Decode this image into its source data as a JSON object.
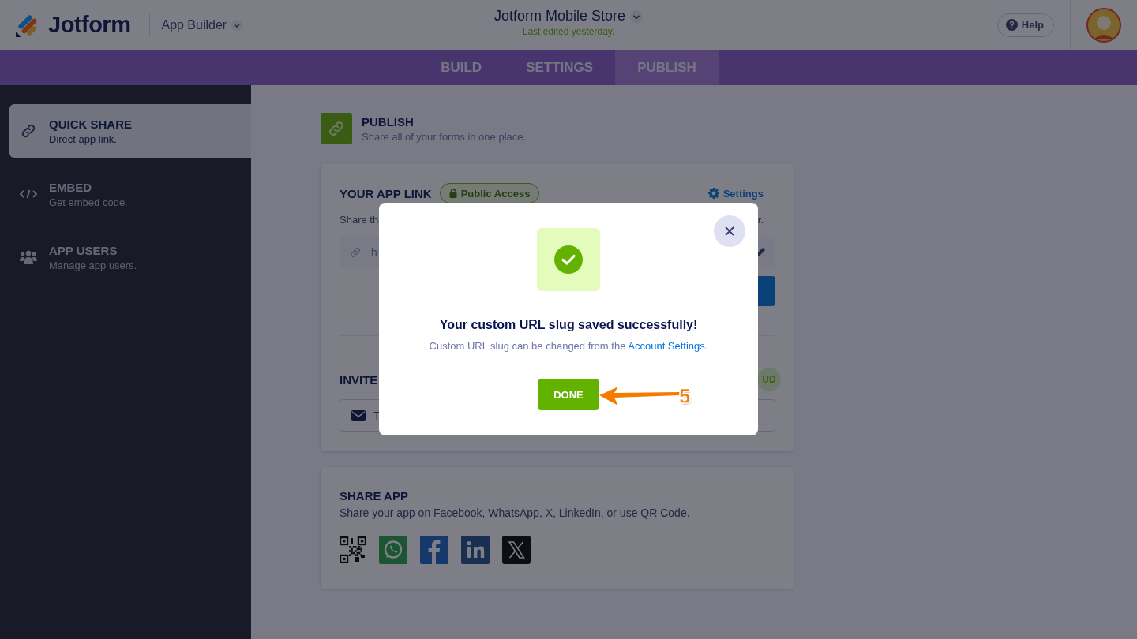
{
  "header": {
    "logo": "Jotform",
    "product": "App Builder",
    "app_title": "Jotform Mobile Store",
    "subtitle": "Last edited yesterday.",
    "help": "Help"
  },
  "tabs": [
    {
      "label": "BUILD",
      "selected": false
    },
    {
      "label": "SETTINGS",
      "selected": false
    },
    {
      "label": "PUBLISH",
      "selected": true
    }
  ],
  "sidebar": {
    "items": [
      {
        "title": "QUICK SHARE",
        "description": "Direct app link.",
        "selected": true
      },
      {
        "title": "EMBED",
        "description": "Get embed code.",
        "selected": false
      },
      {
        "title": "APP USERS",
        "description": "Manage app users.",
        "selected": false
      }
    ]
  },
  "page_header": {
    "title": "PUBLISH",
    "description": "Share all of your forms in one place."
  },
  "app_link_card": {
    "title": "YOUR APP LINK",
    "access_badge": "Public Access",
    "settings_link": "Settings",
    "description_start": "Share th",
    "description_end": "r.",
    "link_value": "h",
    "invite_title": "INVITE",
    "invite_badge": "UD",
    "invite_value": "T"
  },
  "share_card": {
    "title": "SHARE APP",
    "description": "Share your app on Facebook, WhatsApp, X, LinkedIn, or use QR Code."
  },
  "dialog": {
    "title": "Your custom URL slug saved successfully!",
    "message_before": "Custom URL slug can be changed from the ",
    "link": "Account Settings",
    "message_after": ".",
    "done": "DONE"
  },
  "annotation": {
    "step": "5"
  }
}
